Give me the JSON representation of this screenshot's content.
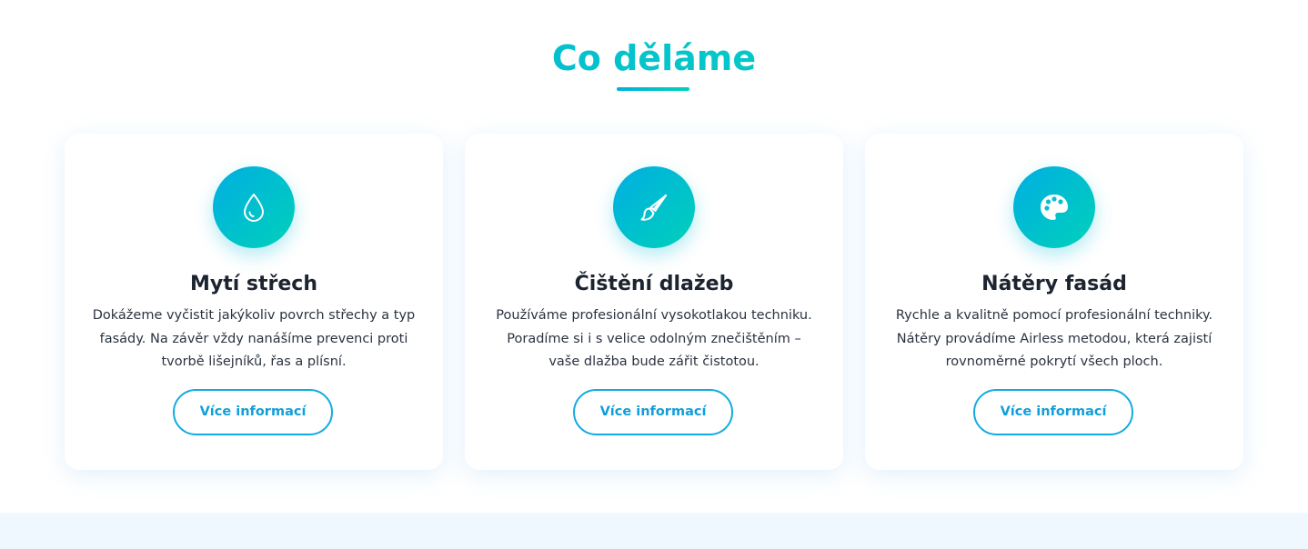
{
  "section": {
    "title": "Co děláme"
  },
  "services": [
    {
      "icon": "water-drop-icon",
      "title": "Mytí střech",
      "lines": [
        "Dokážeme vyčistit jakýkoliv povrch střechy a typ",
        "fasády. Na závěr vždy nanášíme prevenci proti",
        "tvorbě lišejníků, řas a plísní."
      ],
      "button_label": "Více informací"
    },
    {
      "icon": "paintbrush-icon",
      "title": "Čištění dlažeb",
      "lines": [
        "Používáme profesionální vysokotlakou techniku.",
        "Poradíme si i s velice odolným znečištěním –",
        "vaše dlažba bude zářit čistotou."
      ],
      "button_label": "Více informací"
    },
    {
      "icon": "palette-icon",
      "title": "Nátěry fasád",
      "lines": [
        "Rychle a kvalitně pomocí profesionální techniky.",
        "Nátěry provádíme Airless metodou, která zajistí",
        "rovnoměrné pokrytí všech ploch."
      ],
      "button_label": "Více informací"
    }
  ],
  "colors": {
    "accent_start": "#00aee2",
    "accent_end": "#00d1ba",
    "button_border": "#12abe0",
    "title_text": "#1c2430",
    "body_text": "#2b3340",
    "next_section_bg": "#f0f8ff"
  }
}
